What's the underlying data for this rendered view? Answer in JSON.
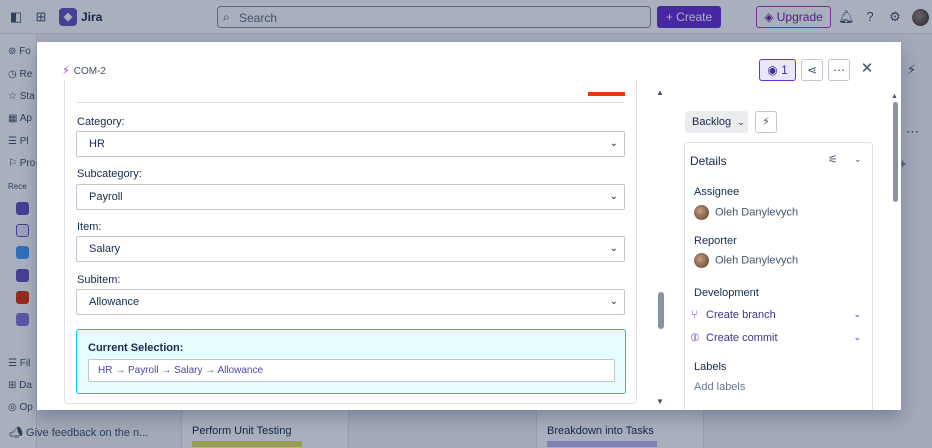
{
  "topbar": {
    "app_name": "Jira",
    "search_placeholder": "Search",
    "create_label": "+ Create",
    "upgrade_label": "Upgrade"
  },
  "sidebar": {
    "items": [
      "Fo",
      "Re",
      "Sta",
      "Ap",
      "Pl",
      "Pro"
    ],
    "recent_label": "Rece",
    "bottom_items": [
      "Fil",
      "Da",
      "Op"
    ],
    "feedback": "Give feedback on the n..."
  },
  "board": {
    "cards": [
      {
        "title": "Perform Unit Testing"
      },
      {
        "title": "Breakdown into Tasks"
      }
    ]
  },
  "modal": {
    "issue_key": "COM-2",
    "watch_count": "1",
    "fields": [
      {
        "label": "Category:",
        "value": "HR"
      },
      {
        "label": "Subcategory:",
        "value": "Payroll"
      },
      {
        "label": "Item:",
        "value": "Salary"
      },
      {
        "label": "Subitem:",
        "value": "Allowance"
      }
    ],
    "current_selection": {
      "title": "Current Selection:",
      "path": "HR → Payroll → Salary → Allowance"
    },
    "status_label": "Backlog",
    "details": {
      "header": "Details",
      "assignee_label": "Assignee",
      "assignee_name": "Oleh Danylevych",
      "reporter_label": "Reporter",
      "reporter_name": "Oleh Danylevych",
      "development_label": "Development",
      "create_branch": "Create branch",
      "create_commit": "Create commit",
      "labels_label": "Labels",
      "add_labels": "Add labels"
    }
  },
  "colors": {
    "accent": "#6b2fd6",
    "upgrade_border": "#c12fcf",
    "selection_bg": "#e6fcff",
    "selection_border": "#00c7e6",
    "red_tab": "#e33b0f"
  }
}
